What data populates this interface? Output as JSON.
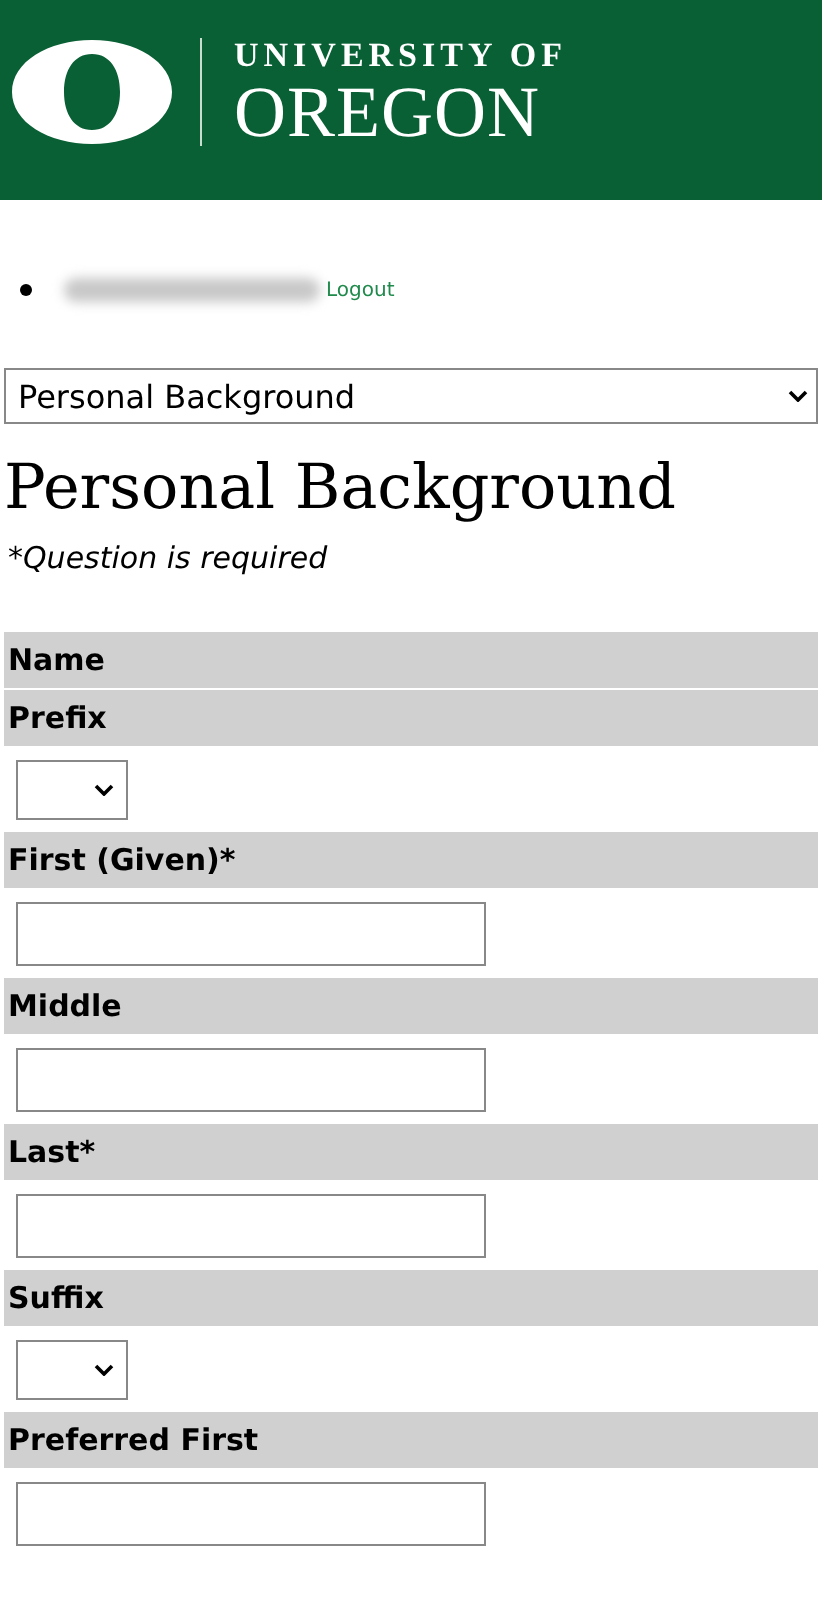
{
  "header": {
    "logo_line1": "UNIVERSITY OF",
    "logo_line2": "OREGON"
  },
  "user_menu": {
    "logout": "Logout"
  },
  "section_select": {
    "value": "Personal Background"
  },
  "heading": "Personal Background",
  "required_note": "*Question is required",
  "group": {
    "title": "Name",
    "fields": [
      {
        "label": "Prefix",
        "kind": "select"
      },
      {
        "label": "First (Given)*",
        "kind": "text"
      },
      {
        "label": "Middle",
        "kind": "text"
      },
      {
        "label": "Last*",
        "kind": "text"
      },
      {
        "label": "Suffix",
        "kind": "select"
      },
      {
        "label": "Preferred First",
        "kind": "text"
      }
    ]
  }
}
